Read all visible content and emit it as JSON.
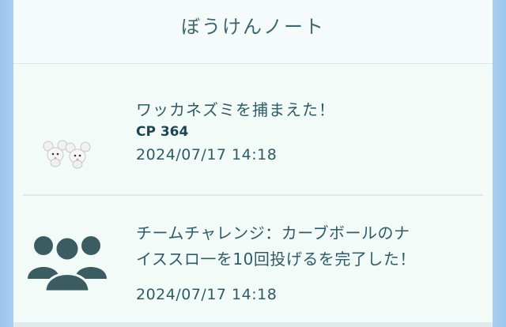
{
  "header": {
    "title": "ぼうけんノート"
  },
  "entries": [
    {
      "title": "ワッカネズミを捕まえた！",
      "cp": "CP 364",
      "timestamp": "2024/07/17 14:18",
      "icon": "pokemon-icon"
    },
    {
      "title_line1": "チームチャレンジ：カーブボールのナ",
      "title_line2": "イススロ一を10回投げるを完了した！",
      "timestamp": "2024/07/17 14:18",
      "icon": "team-icon"
    }
  ]
}
